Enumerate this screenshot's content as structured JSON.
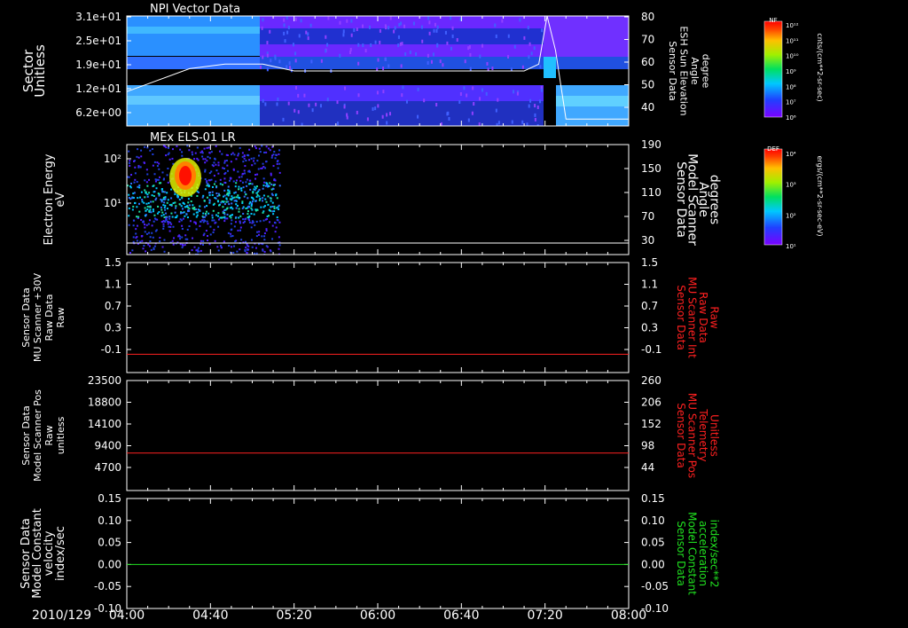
{
  "date_label": "2010/129",
  "x_ticks": [
    "04:00",
    "04:40",
    "05:20",
    "06:00",
    "06:40",
    "07:20",
    "08:00"
  ],
  "colors": {
    "axis": "#ffffff",
    "red": "#ff2020",
    "green": "#20e020",
    "panel_bg": "#000000"
  },
  "panels": [
    {
      "title": "NPI Vector Data",
      "left_label": [
        "Sector",
        "Unitless"
      ],
      "left_ticks": [
        "3.1e+01",
        "2.5e+01",
        "1.9e+01",
        "1.2e+01",
        "6.2e+00"
      ],
      "right_ticks": [
        "80",
        "70",
        "60",
        "50",
        "40"
      ],
      "right_label": [
        "Sensor Data",
        "ESH Sun Elevation",
        "Angle",
        "degree"
      ],
      "colorbar": {
        "title": "NF",
        "ticks": [
          "10¹²",
          "10¹¹",
          "10¹⁰",
          "10⁹",
          "10⁸",
          "10⁷",
          "10⁶"
        ],
        "units": "cnts/(cm**2-sr-sec)"
      }
    },
    {
      "title": "MEx ELS-01 LR",
      "left_label": [
        "Electron Energy",
        "eV"
      ],
      "left_ticks": [
        "10²",
        "10¹"
      ],
      "right_ticks": [
        "190",
        "150",
        "110",
        "70",
        "30"
      ],
      "right_label": [
        "Sensor Data",
        "Model Scanner",
        "Angle",
        "degrees"
      ],
      "colorbar": {
        "title": "DEF",
        "ticks": [
          "10⁴",
          "10³",
          "10²",
          "10¹"
        ],
        "units": "ergs/(cm**2-sr-sec-eV)"
      }
    },
    {
      "left_label": [
        "Sensor Data",
        "MU Scanner +30V",
        "Raw Data",
        "Raw"
      ],
      "left_ticks": [
        "1.5",
        "1.1",
        "0.7",
        "0.3",
        "-0.1"
      ],
      "right_ticks": [
        "1.5",
        "1.1",
        "0.7",
        "0.3",
        "-0.1"
      ],
      "right_label": [
        "Sensor Data",
        "MU Scanner Int",
        "Raw Data",
        "Raw"
      ]
    },
    {
      "left_label": [
        "Sensor Data",
        "Model Scanner Pos",
        "Raw",
        "unitless"
      ],
      "left_ticks": [
        "23500",
        "18800",
        "14100",
        "9400",
        "4700"
      ],
      "right_ticks": [
        "260",
        "206",
        "152",
        "98",
        "44"
      ],
      "right_label": [
        "Sensor Data",
        "MU Scanner Pos",
        "Telemetry",
        "Unitless"
      ]
    },
    {
      "left_label": [
        "Sensor Data",
        "Model Constant",
        "velocity",
        "index/sec"
      ],
      "left_ticks": [
        "0.15",
        "0.10",
        "0.05",
        "0.00",
        "-0.05",
        "-0.10"
      ],
      "right_ticks": [
        "0.15",
        "0.10",
        "0.05",
        "0.00",
        "-0.05",
        "-0.10"
      ],
      "right_label": [
        "Sensor Data",
        "Model Constant",
        "acceleration",
        "index/sec**2"
      ]
    }
  ],
  "chart_data": [
    {
      "type": "heatmap",
      "title": "NPI Vector Data",
      "ylabel": "Sector Unitless",
      "yticks": [
        31,
        25,
        19,
        12,
        6.2
      ],
      "y2label": "Sensor Data ESH Sun Elevation Angle degree",
      "y2lim": [
        32,
        80
      ],
      "x": [
        "04:00",
        "04:30",
        "04:47",
        "05:05",
        "05:20",
        "06:00",
        "07:10",
        "07:17",
        "07:21",
        "07:25",
        "07:30",
        "08:00"
      ],
      "line_y2": [
        47,
        57,
        59,
        59,
        56,
        56,
        56,
        59,
        80,
        65,
        35,
        35
      ]
    },
    {
      "type": "heatmap",
      "title": "MEx ELS-01 LR",
      "ylabel": "Electron Energy eV",
      "yscale": "log",
      "y2label": "Sensor Data Model Scanner Angle degrees",
      "y2lim": [
        0,
        190
      ],
      "data_xrange": [
        "04:00",
        "05:13"
      ],
      "peak": {
        "x": "04:28",
        "y": 40
      }
    },
    {
      "type": "line",
      "ylabel": "Sensor Data MU Scanner +30V Raw Data Raw",
      "ylim": [
        -0.3,
        1.5
      ],
      "y2label": "Sensor Data MU Scanner Int Raw Data Raw",
      "x": [
        "04:00",
        "08:00"
      ],
      "values": [
        0,
        0
      ]
    },
    {
      "type": "line",
      "ylabel": "Sensor Data Model Scanner Pos Raw unitless",
      "ylim": [
        0,
        23500
      ],
      "y2label": "Sensor Data MU Scanner Pos Telemetry Unitless",
      "x": [
        "04:00",
        "08:00"
      ],
      "values": [
        8000,
        8000
      ]
    },
    {
      "type": "line",
      "ylabel": "Sensor Data Model Constant velocity index/sec",
      "ylim": [
        -0.1,
        0.15
      ],
      "y2label": "Sensor Data Model Constant acceleration index/sec**2",
      "x": [
        "04:00",
        "08:00"
      ],
      "values": [
        0.0,
        0.0
      ]
    }
  ]
}
